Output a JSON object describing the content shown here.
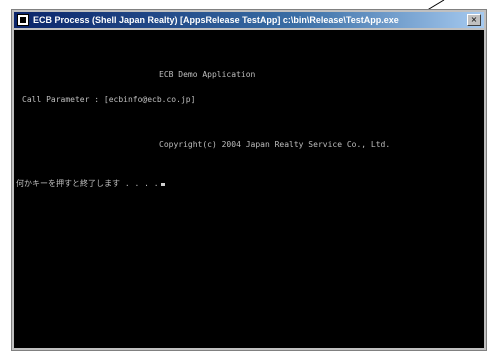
{
  "window": {
    "title": "ECB Process  (Shell Japan Realty)  [AppsRelease  TestApp]  c:\\bin\\Release\\TestApp.exe",
    "close_label": "×"
  },
  "console": {
    "lines": [
      "ECB Demo Application",
      "Call Parameter : [ecbinfo@ecb.co.jp]",
      "Copyright(c) 2004 Japan Realty Service Co., Ltd.",
      "何かキーを押すと終了します . . . ."
    ]
  }
}
